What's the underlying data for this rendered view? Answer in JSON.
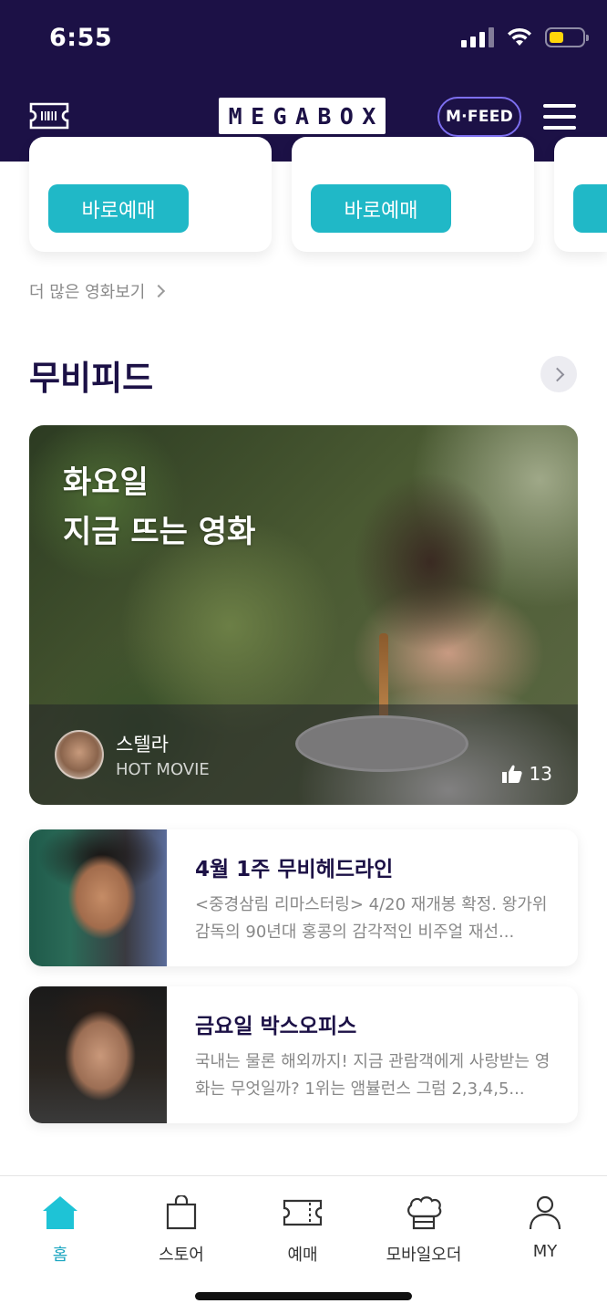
{
  "status_bar": {
    "time": "6:55"
  },
  "header": {
    "logo_letters": [
      "M",
      "E",
      "G",
      "A",
      "B",
      "O",
      "X"
    ],
    "mfeed_label": "M·FEED",
    "brand_color": "#1c1146"
  },
  "movie_cards": [
    {
      "book_label": "바로예매"
    },
    {
      "book_label": "바로예매"
    }
  ],
  "more_movies_label": "더 많은 영화보기",
  "movie_feed": {
    "title": "무비피드",
    "feature": {
      "title_line1": "화요일",
      "title_line2": "지금 뜨는 영화",
      "movie_name": "스텔라",
      "tag": "HOT MOVIE",
      "likes": "13"
    },
    "items": [
      {
        "title": "4월 1주 무비헤드라인",
        "desc": "<중경삼림 리마스터링> 4/20 재개봉 확정. 왕가위 감독의 90년대 홍콩의 감각적인 비주얼 재선..."
      },
      {
        "title": "금요일 박스오피스",
        "desc": "국내는 물론 해외까지! 지금 관람객에게 사랑받는 영화는 무엇일까? 1위는 앰뷸런스 그럼 2,3,4,5..."
      }
    ]
  },
  "bottom_nav": {
    "items": [
      {
        "label": "홈",
        "icon": "home-icon",
        "active": true
      },
      {
        "label": "스토어",
        "icon": "shopping-bag-icon"
      },
      {
        "label": "예매",
        "icon": "ticket-icon"
      },
      {
        "label": "모바일오더",
        "icon": "chef-hat-icon"
      },
      {
        "label": "MY",
        "icon": "user-icon"
      }
    ]
  },
  "accent_color": "#20b8c7"
}
